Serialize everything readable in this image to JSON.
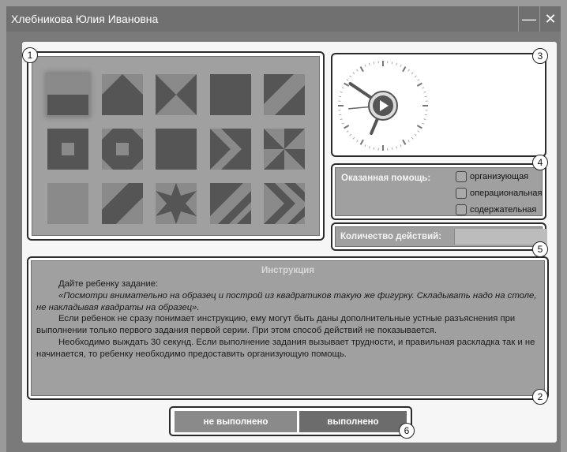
{
  "window": {
    "title": "Хлебникова Юлия Ивановна",
    "minimize_glyph": "—",
    "close_glyph": "✕"
  },
  "callouts": [
    "1",
    "2",
    "3",
    "4",
    "5",
    "6"
  ],
  "patterns": {
    "selected_index": 0,
    "tiles": [
      "half-horizontal",
      "triangle-up",
      "hourglass",
      "solid",
      "diagonal-stripe",
      "small-square",
      "octagon-ring",
      "solid",
      "chevron",
      "pinwheel",
      "solid-light",
      "diagonal-band",
      "star",
      "double-diagonal",
      "zigzag-arrows"
    ]
  },
  "timer": {
    "icon": "play-icon",
    "hand_angles_deg": {
      "hour": 23,
      "minute": -56,
      "second": 85
    }
  },
  "help": {
    "title": "Оказанная помощь:",
    "options": [
      "организующая",
      "операциональная",
      "содержательная"
    ]
  },
  "actions": {
    "label": "Количество действий:",
    "value": ""
  },
  "instruction": {
    "title": "Инструкция",
    "paragraphs": [
      "Дайте ребенку задание:",
      "«Посмотри внимательно на образец и построй из квадратиков такую же фигурку. Складывать надо на столе, не накладывая квадраты на образец».",
      "Если ребенок не сразу понимает инструкцию, ему могут быть даны дополнительные устные разъяснения при выполнении только первого задания первой серии. При этом способ действий не показывается.",
      "Необходимо выждать 30 секунд. Если выполнение задания вызывает трудности, и правильная раскладка так и не начинается, то ребенку необходимо предоставить организующую помощь."
    ]
  },
  "buttons": {
    "not_done": "не выполнено",
    "done": "выполнено"
  },
  "colors": {
    "dark_tile": "#555555",
    "light_tile": "#8a8a8a",
    "panel_fill": "#a0a0a0"
  }
}
